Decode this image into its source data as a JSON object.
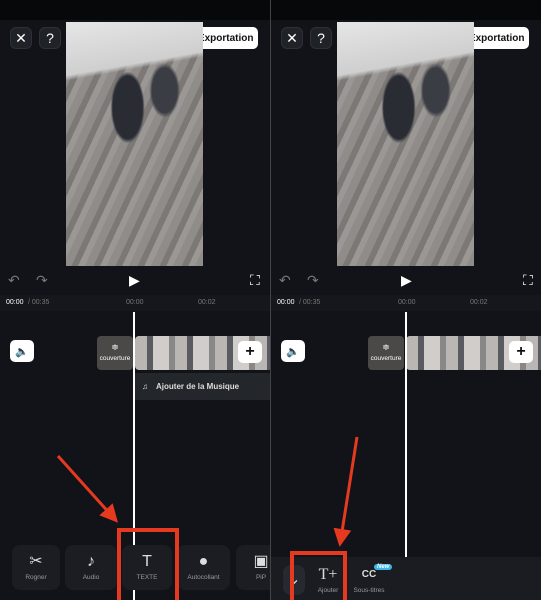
{
  "left": {
    "export_label": "Exportation",
    "time_current": "00:00",
    "time_total": "/ 00:35",
    "ruler": [
      "00:00",
      "00:02"
    ],
    "cover_label": "couverture",
    "music_label": "Ajouter de la Musique",
    "toolbar": [
      {
        "label": "Rogner",
        "icon": "scissors-icon",
        "glyph": "✂"
      },
      {
        "label": "Audio",
        "icon": "music-note-icon",
        "glyph": "♪"
      },
      {
        "label": "TEXTE",
        "icon": "text-icon",
        "glyph": "T"
      },
      {
        "label": "Autocollant",
        "icon": "sticker-icon",
        "glyph": "●"
      },
      {
        "label": "PiP",
        "icon": "picture-in-picture-icon",
        "glyph": "▣"
      }
    ]
  },
  "right": {
    "export_label": "Exportation",
    "time_current": "00:00",
    "time_total": "/ 00:35",
    "ruler": [
      "00:00",
      "00:02"
    ],
    "cover_label": "couverture",
    "text_toolbar": [
      {
        "label": "Ajouter",
        "icon": "add-text-icon",
        "glyph": "T+"
      },
      {
        "label": "Sous-titres",
        "icon": "ai-captions-icon",
        "glyph": "CC",
        "badge": "New"
      }
    ]
  },
  "colors": {
    "highlight": "#e53a1f",
    "background": "#111318"
  }
}
